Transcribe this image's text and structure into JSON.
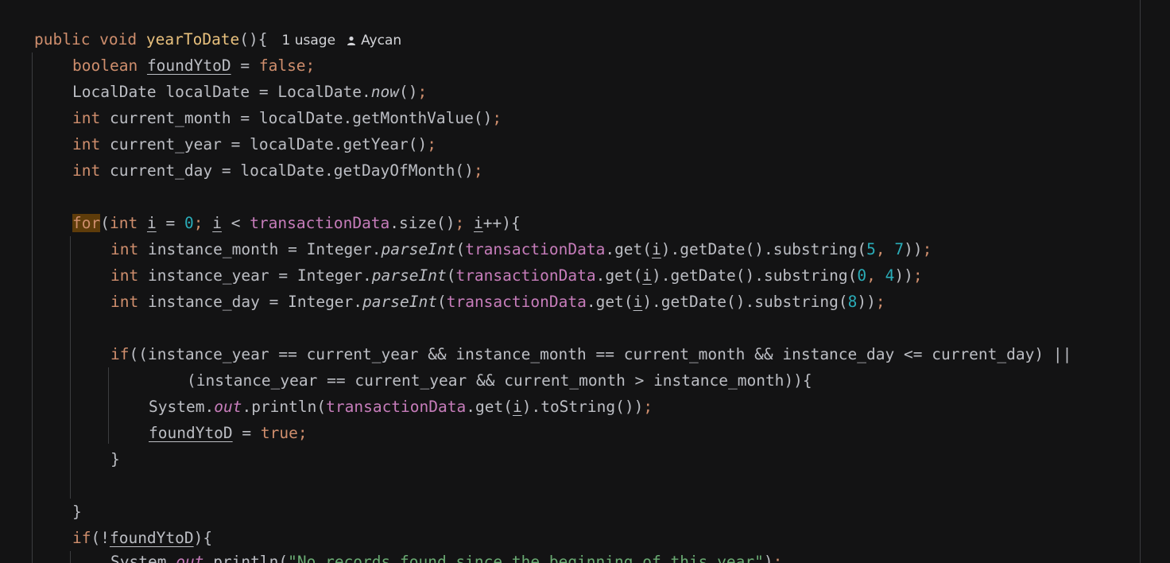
{
  "editor": {
    "method_signature": {
      "modifiers": "public void ",
      "name": "yearToDate",
      "params": "(){",
      "usages": "1 usage",
      "author": "Aycan",
      "author_icon": "person-icon"
    },
    "tokens": {
      "boolean": "boolean",
      "foundYtoD": "foundYtoD",
      "false": "false",
      "true": "true",
      "int": "int",
      "for": "for",
      "if": "if",
      "LocalDate": "LocalDate",
      "localDate": "localDate",
      "now": "now",
      "current_month": "current_month",
      "current_year": "current_year",
      "current_day": "current_day",
      "getMonthValue": "getMonthValue",
      "getYear": "getYear",
      "getDayOfMonth": "getDayOfMonth",
      "i": "i",
      "zero": "0",
      "transactionData": "transactionData",
      "size": "size",
      "instance_month": "instance_month",
      "instance_year": "instance_year",
      "instance_day": "instance_day",
      "Integer": "Integer",
      "parseInt": "parseInt",
      "get": "get",
      "getDate": "getDate",
      "substring": "substring",
      "five": "5",
      "seven": "7",
      "four": "4",
      "eight": "8",
      "System": "System",
      "out": "out",
      "println": "println",
      "toString": "toString",
      "no_records_string": "\"No records found since the beginning of this year\""
    }
  },
  "colors": {
    "background": "#131314",
    "keyword": "#cf8e6d",
    "method_decl": "#e8c07d",
    "number": "#2aacb8",
    "string": "#6aab73",
    "field": "#c77dbb",
    "text": "#bcbec4",
    "highlight": "#5e3c0a"
  }
}
